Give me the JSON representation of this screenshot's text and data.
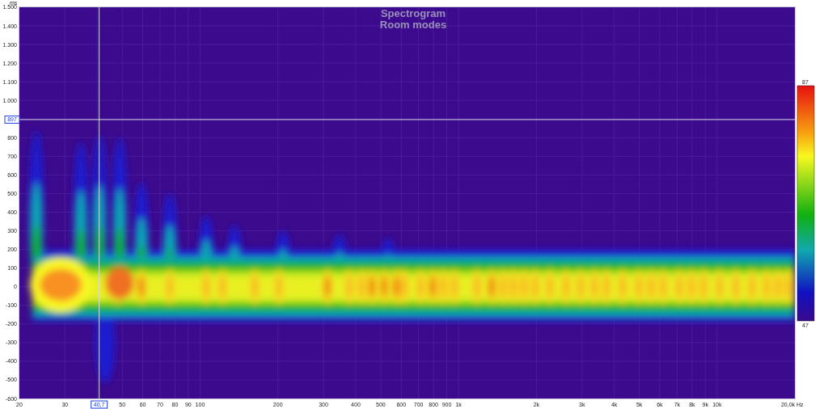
{
  "chart": {
    "title": "Spectrogram",
    "subtitle": "Room modes",
    "y_unit": "ms",
    "y_ticks": [
      "1.500",
      "1.400",
      "1.300",
      "1.200",
      "1.100",
      "1.000",
      "800",
      "700",
      "600",
      "500",
      "400",
      "300",
      "200",
      "100",
      "0",
      "-100",
      "-200",
      "-300",
      "-400",
      "-500",
      "-600"
    ],
    "x_ticks": [
      "20",
      "30",
      "50",
      "60",
      "70",
      "80",
      "90",
      "100",
      "200",
      "300",
      "400",
      "500",
      "600",
      "700",
      "800",
      "900",
      "1k",
      "2k",
      "3k",
      "4k",
      "5k",
      "6k",
      "7k",
      "8k",
      "9k",
      "10k",
      "20,0k"
    ],
    "x_unit": "Hz",
    "cursor": {
      "time_readout": "897",
      "frequency_readout": "40,7"
    },
    "color_scale": {
      "max_label": "87",
      "min_label": "47"
    }
  }
}
